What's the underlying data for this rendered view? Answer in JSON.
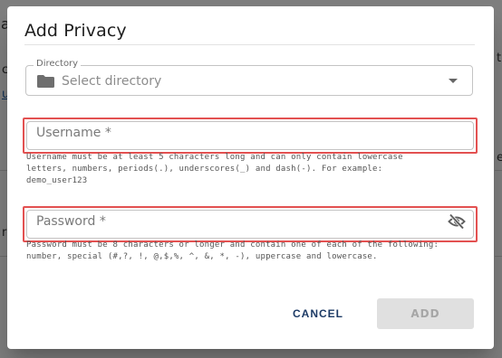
{
  "background": {
    "fragment_a": "a",
    "fragment_c": "c",
    "fragment_r": "r",
    "fragment_u": "u",
    "fragment_e": "e",
    "fragment_t": "t"
  },
  "dialog": {
    "title": "Add Privacy",
    "directory": {
      "legend": "Directory",
      "placeholder": "Select directory",
      "icon": "folder-icon"
    },
    "username": {
      "label": "Username *",
      "value": "",
      "helper_lines": [
        "Username must be at least 5 characters long and can only contain lowercase",
        "letters, numbers, periods(.), underscores(_) and dash(-). For example:",
        "demo_user123"
      ]
    },
    "password": {
      "label": "Password *",
      "value": "",
      "visibility_icon": "eye-off-icon",
      "helper_lines": [
        "Password must be 8 characters or longer and contain one of each of the following:",
        "number, special (#,?, !, @,$,%, ^, &, *, -), uppercase and lowercase."
      ]
    },
    "actions": {
      "cancel_label": "CANCEL",
      "add_label": "ADD"
    }
  },
  "colors": {
    "highlight": "#e35151",
    "cancel_text": "#1d3b66",
    "add_disabled_bg": "#e0e0e0"
  }
}
